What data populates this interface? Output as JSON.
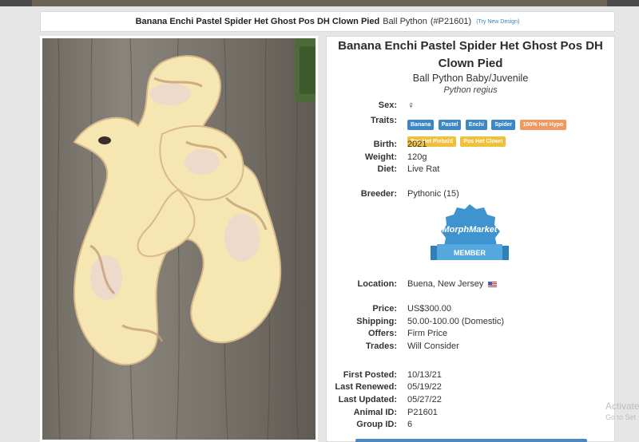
{
  "header": {
    "title_bold": "Banana Enchi Pastel Spider Het Ghost Pos DH Clown Pied",
    "species": "Ball Python",
    "id": "(#P21601)",
    "try_link": "(Try New Design)"
  },
  "listing": {
    "title": "Banana Enchi Pastel Spider Het Ghost Pos DH Clown Pied",
    "subtitle": "Ball Python Baby/Juvenile",
    "latin": "Python regius"
  },
  "details": {
    "sex_label": "Sex:",
    "sex_value": "♀",
    "traits_label": "Traits:",
    "traits": [
      {
        "text": "Banana",
        "color": "blue"
      },
      {
        "text": "Pastel",
        "color": "blue"
      },
      {
        "text": "Enchi",
        "color": "blue"
      },
      {
        "text": "Spider",
        "color": "blue"
      },
      {
        "text": "100% Het Hypo",
        "color": "orange"
      },
      {
        "text": "Pos Het Piebald",
        "color": "yellow"
      },
      {
        "text": "Pos Het Clown",
        "color": "yellow"
      }
    ],
    "birth_label": "Birth:",
    "birth_value": "2021",
    "weight_label": "Weight:",
    "weight_value": "120g",
    "diet_label": "Diet:",
    "diet_value": "Live Rat",
    "breeder_label": "Breeder:",
    "breeder_value": "Pythonic (15)",
    "badge_top": "MorphMarket",
    "badge_bottom": "MEMBER",
    "location_label": "Location:",
    "location_value": "Buena, New Jersey",
    "price_label": "Price:",
    "price_value": "US$300.00",
    "shipping_label": "Shipping:",
    "shipping_value": "50.00-100.00 (Domestic)",
    "offers_label": "Offers:",
    "offers_value": "Firm Price",
    "trades_label": "Trades:",
    "trades_value": "Will Consider",
    "first_posted_label": "First Posted:",
    "first_posted_value": "10/13/21",
    "last_renewed_label": "Last Renewed:",
    "last_renewed_value": "05/19/22",
    "last_updated_label": "Last Updated:",
    "last_updated_value": "05/27/22",
    "animal_id_label": "Animal ID:",
    "animal_id_value": "P21601",
    "group_id_label": "Group ID:",
    "group_id_value": "6"
  },
  "overlay": {
    "activate_line1": "Activate",
    "activate_line2": "Go to Set"
  },
  "colors": {
    "accent_blue": "#3e87c6",
    "tag_orange": "#f0985e",
    "tag_yellow": "#f2c038",
    "female_pink": "#e0529c"
  }
}
